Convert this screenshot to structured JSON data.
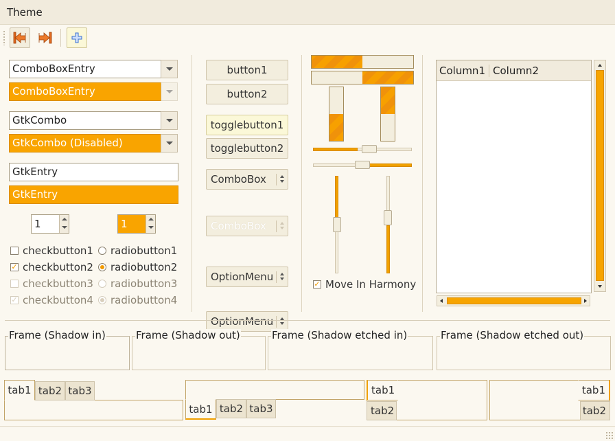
{
  "menubar": {
    "theme": "Theme"
  },
  "toolbar": {
    "icons": [
      "go-first-icon",
      "go-last-icon",
      "add-icon"
    ],
    "accent": "#e36a1e",
    "add_color": "#3a6fd0"
  },
  "left": {
    "comboboxentry": "ComboBoxEntry",
    "comboboxentry_selected": "ComboBoxEntry",
    "gtkcombo": "GtkCombo",
    "gtkcombo_disabled": "GtkCombo (Disabled)",
    "gtkentry": "GtkEntry",
    "gtkentry_selected": "GtkEntry",
    "spin1": "1",
    "spin2": "1",
    "checks": [
      {
        "check": "checkbutton1",
        "checked": false,
        "radio": "radiobutton1",
        "selected": false
      },
      {
        "check": "checkbutton2",
        "checked": true,
        "radio": "radiobutton2",
        "selected": true
      },
      {
        "check": "checkbutton3",
        "checked": false,
        "radio": "radiobutton3",
        "selected": false
      },
      {
        "check": "checkbutton4",
        "checked": true,
        "radio": "radiobutton4",
        "selected": true
      }
    ]
  },
  "buttons": {
    "button1": "button1",
    "button2": "button2",
    "toggle1": "togglebutton1",
    "toggle2": "togglebutton2",
    "combo1": "ComboBox",
    "combo2": "ComboBox",
    "option1": "OptionMenu",
    "option2": "OptionMenu"
  },
  "ranges": {
    "progress_h1": 0.5,
    "progress_h2": 0.5,
    "progress_v1": 0.5,
    "progress_v2": 0.5,
    "hscale1": 0.5,
    "hscale2": 0.5,
    "vscale1": 0.5,
    "vscale2": 0.5,
    "move_in_harmony": "Move In Harmony",
    "fill_color": "#f7a000"
  },
  "tree": {
    "columns": [
      "Column1",
      "Column2"
    ]
  },
  "frames": {
    "in": "Frame (Shadow in)",
    "out": "Frame (Shadow out)",
    "etched_in": "Frame (Shadow etched in)",
    "etched_out": "Frame (Shadow etched out)"
  },
  "tabs": {
    "tab1": "tab1",
    "tab2": "tab2",
    "tab3": "tab3"
  }
}
